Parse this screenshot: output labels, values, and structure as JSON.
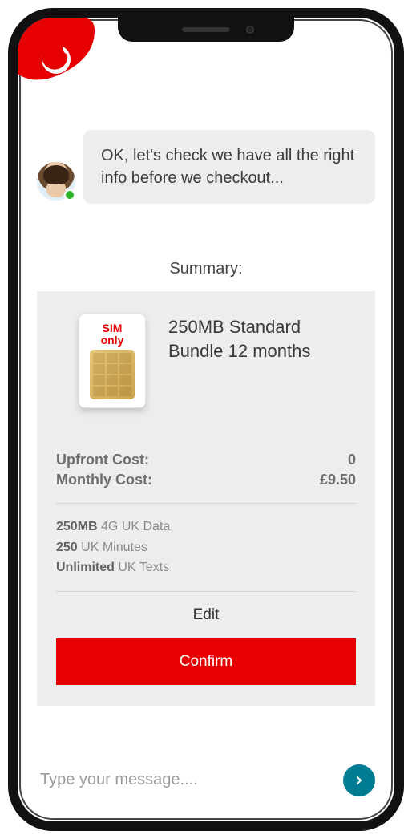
{
  "brand": {
    "accent": "#e60000",
    "teal": "#007c92"
  },
  "chat": {
    "message": "OK, let's check we have all the right info before we checkout...",
    "presence": "online"
  },
  "summary": {
    "title": "Summary:",
    "product_name": "250MB Standard Bundle 12 months",
    "sim_label_line1": "SIM",
    "sim_label_line2": "only",
    "upfront_label": "Upfront Cost:",
    "upfront_value": "0",
    "monthly_label": "Monthly Cost:",
    "monthly_value": "£9.50",
    "features": [
      {
        "amount": "250MB",
        "desc": "4G UK Data"
      },
      {
        "amount": "250",
        "desc": "UK Minutes"
      },
      {
        "amount": "Unlimited",
        "desc": "UK Texts"
      }
    ],
    "edit_label": "Edit",
    "confirm_label": "Confirm"
  },
  "input": {
    "placeholder": "Type your message...."
  }
}
